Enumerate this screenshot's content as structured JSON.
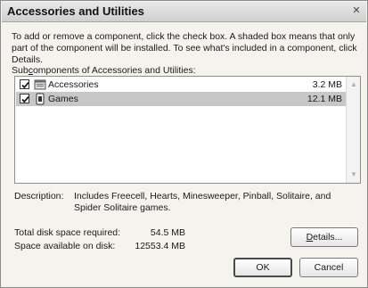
{
  "window": {
    "title": "Accessories and Utilities",
    "close_glyph": "✕"
  },
  "instructions": "To add or remove a component, click the check box. A shaded box means that only part of the component will be installed. To see what's included in a component, click Details.",
  "subcomponents": {
    "label_pre": "Sub",
    "label_mnemonic": "c",
    "label_post": "omponents of Accessories and Utilities:",
    "items": [
      {
        "name": "Accessories",
        "size": "3.2 MB",
        "checked": true,
        "selected": false,
        "icon": "accessories-icon"
      },
      {
        "name": "Games",
        "size": "12.1 MB",
        "checked": true,
        "selected": true,
        "icon": "games-icon"
      }
    ]
  },
  "description": {
    "label": "Description:",
    "text": "Includes Freecell, Hearts, Minesweeper, Pinball, Solitaire, and Spider Solitaire games."
  },
  "disk": {
    "required_label": "Total disk space required:",
    "required_value": "54.5 MB",
    "available_label": "Space available on disk:",
    "available_value": "12553.4 MB"
  },
  "buttons": {
    "details_pre": "",
    "details_mnemonic": "D",
    "details_post": "etails...",
    "ok": "OK",
    "cancel": "Cancel"
  },
  "scrollbar": {
    "up_glyph": "▲",
    "down_glyph": "▼"
  }
}
